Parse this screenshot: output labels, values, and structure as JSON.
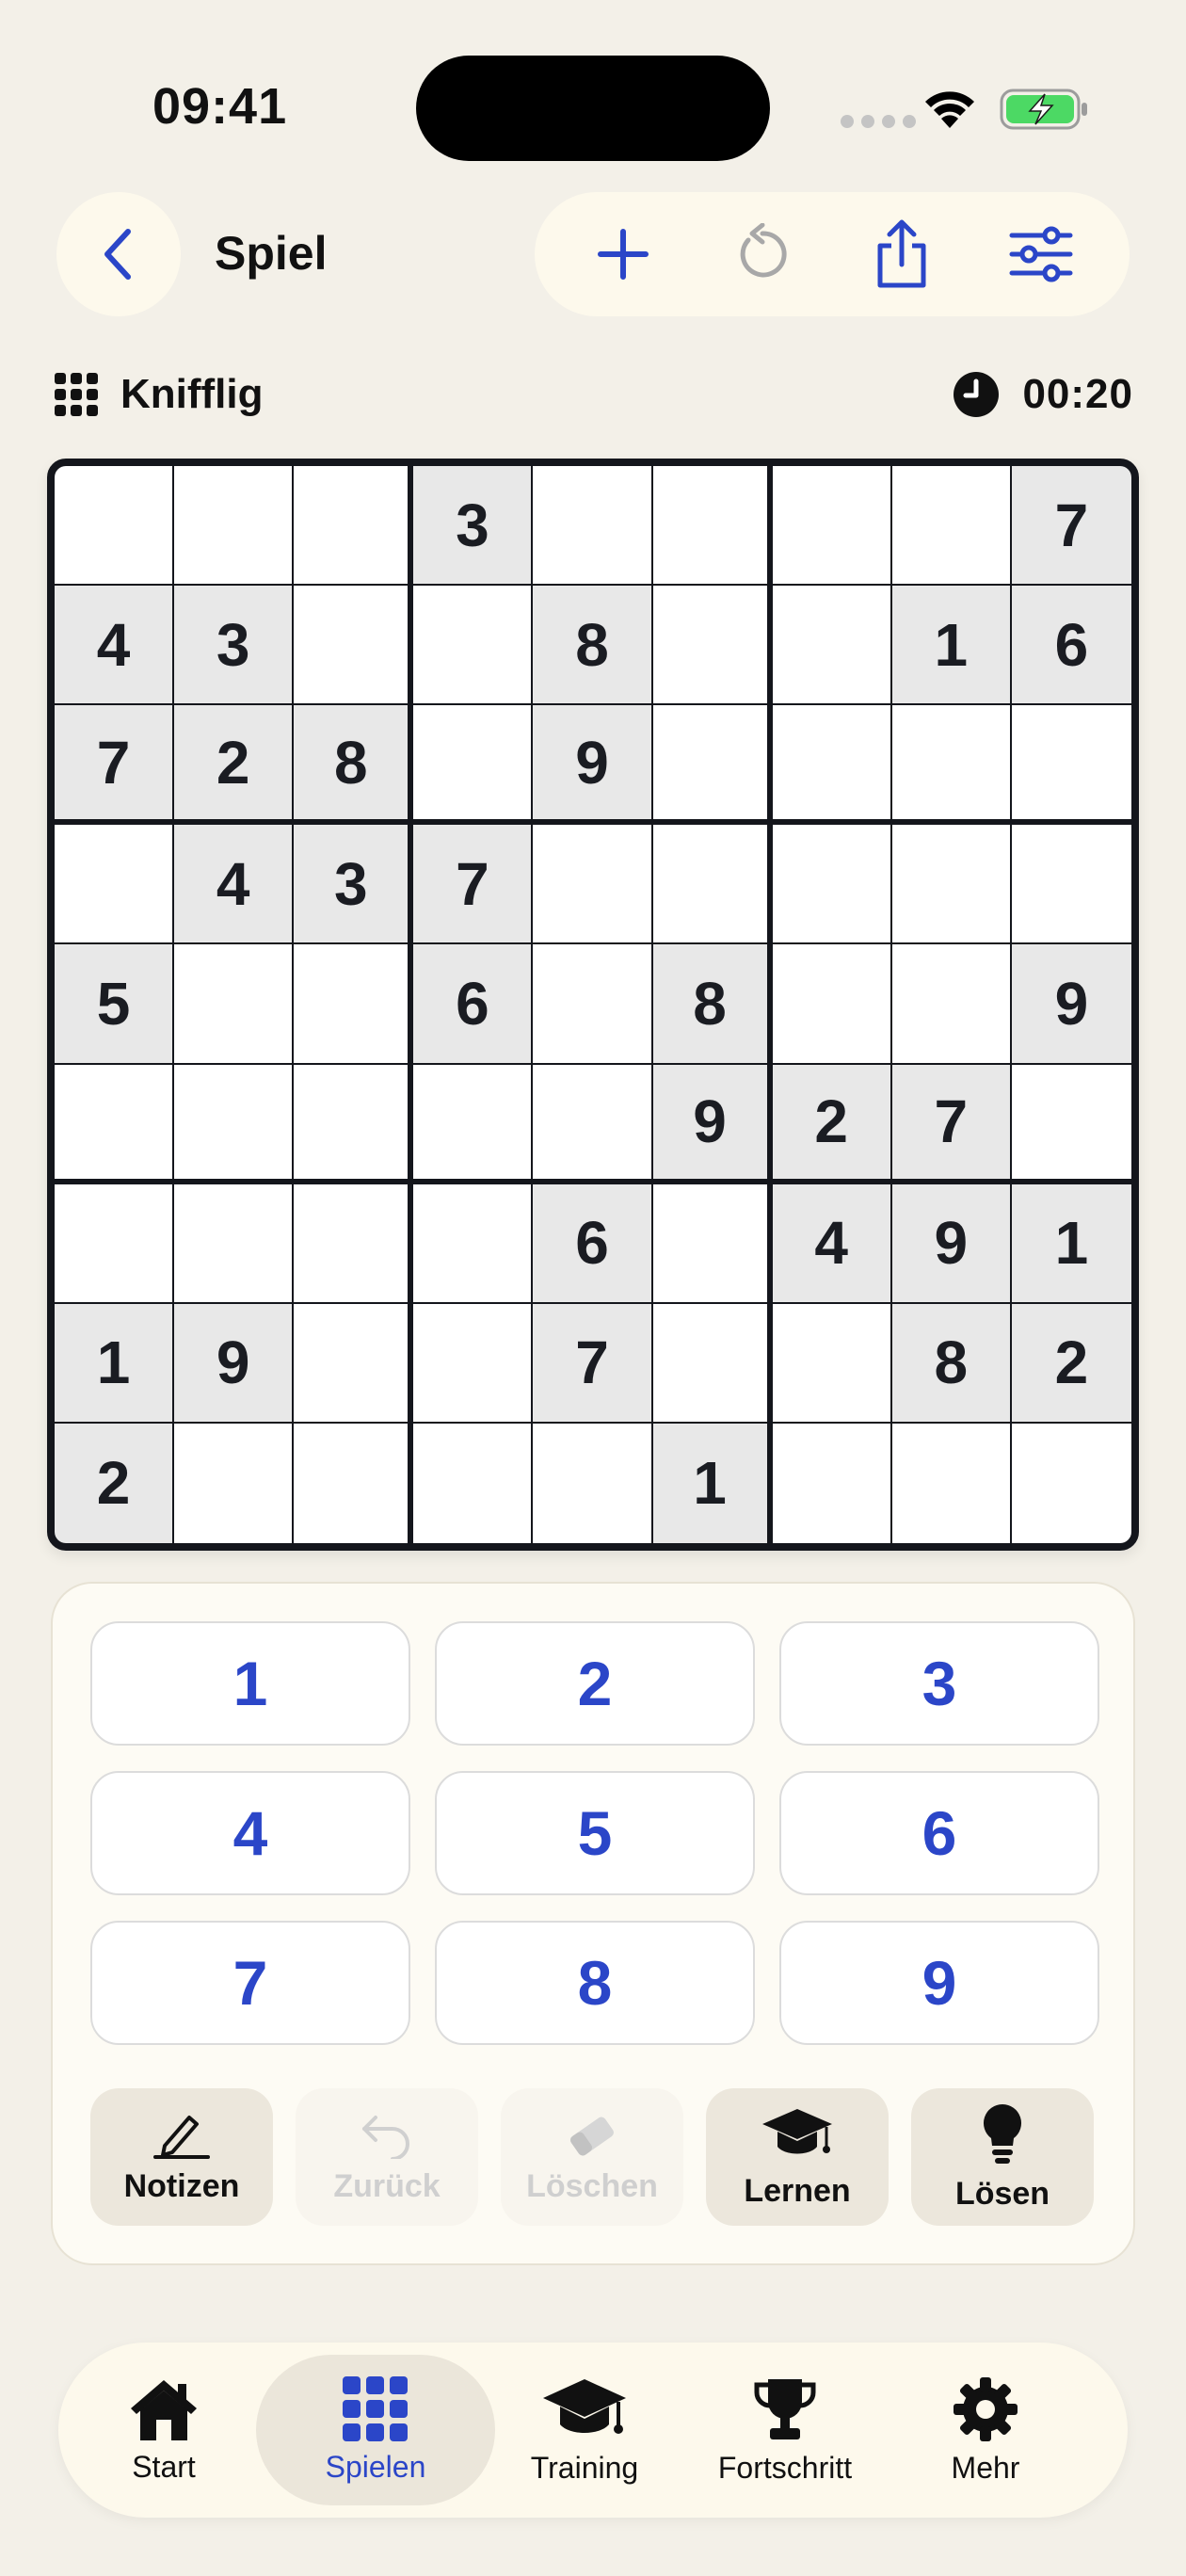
{
  "status_bar": {
    "time": "09:41"
  },
  "header": {
    "title": "Spiel"
  },
  "toolbar": {
    "icons": [
      "plus-icon",
      "restart-icon",
      "share-icon",
      "sliders-icon"
    ]
  },
  "game_info": {
    "difficulty": "Knifflig",
    "timer": "00:20"
  },
  "board": {
    "rows": [
      [
        "",
        "",
        "",
        "3",
        "",
        "",
        "",
        "",
        "7"
      ],
      [
        "4",
        "3",
        "",
        "",
        "8",
        "",
        "",
        "1",
        "6"
      ],
      [
        "7",
        "2",
        "8",
        "",
        "9",
        "",
        "",
        "",
        ""
      ],
      [
        "",
        "4",
        "3",
        "7",
        "",
        "",
        "",
        "",
        ""
      ],
      [
        "5",
        "",
        "",
        "6",
        "",
        "8",
        "",
        "",
        "9"
      ],
      [
        "",
        "",
        "",
        "",
        "",
        "9",
        "2",
        "7",
        ""
      ],
      [
        "",
        "",
        "",
        "",
        "6",
        "",
        "4",
        "9",
        "1"
      ],
      [
        "1",
        "9",
        "",
        "",
        "7",
        "",
        "",
        "8",
        "2"
      ],
      [
        "2",
        "",
        "",
        "",
        "",
        "1",
        "",
        "",
        ""
      ]
    ]
  },
  "numpad": [
    "1",
    "2",
    "3",
    "4",
    "5",
    "6",
    "7",
    "8",
    "9"
  ],
  "actions": [
    {
      "label": "Notizen",
      "icon": "pencil-icon",
      "enabled": true
    },
    {
      "label": "Zurück",
      "icon": "undo-icon",
      "enabled": false
    },
    {
      "label": "Löschen",
      "icon": "eraser-icon",
      "enabled": false
    },
    {
      "label": "Lernen",
      "icon": "graduation-cap-icon",
      "enabled": true
    },
    {
      "label": "Lösen",
      "icon": "lightbulb-icon",
      "enabled": true
    }
  ],
  "tabs": [
    {
      "label": "Start",
      "icon": "house-icon",
      "active": false
    },
    {
      "label": "Spielen",
      "icon": "grid-icon",
      "active": true
    },
    {
      "label": "Training",
      "icon": "graduation-cap-icon",
      "active": false
    },
    {
      "label": "Fortschritt",
      "icon": "trophy-icon",
      "active": false
    },
    {
      "label": "Mehr",
      "icon": "gear-icon",
      "active": false
    }
  ],
  "colors": {
    "accent": "#2b46c8",
    "background": "#f3f0e8",
    "given_cell": "#e8e8e8",
    "battery": "#4cd964"
  }
}
